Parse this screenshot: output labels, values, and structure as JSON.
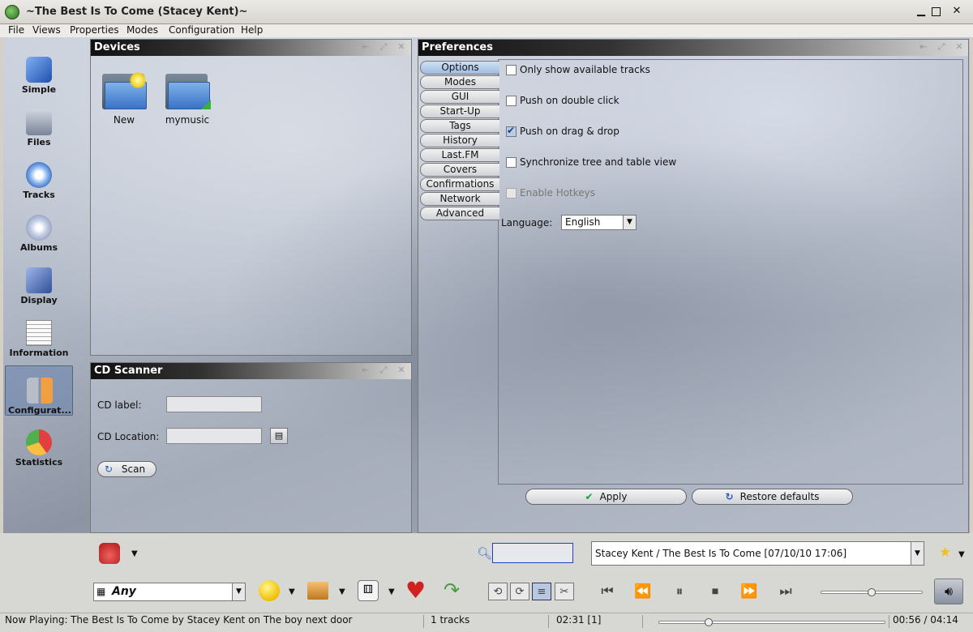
{
  "window": {
    "title": "~The Best Is To Come (Stacey Kent)~"
  },
  "menu": [
    "File",
    "Views",
    "Properties",
    "Modes",
    "Configuration",
    "Help"
  ],
  "perspectives": [
    {
      "label": "Simple",
      "icon": "cube-icon",
      "color": "#3a6fd0"
    },
    {
      "label": "Files",
      "icon": "harddisk-icon",
      "color": "#8a94a8"
    },
    {
      "label": "Tracks",
      "icon": "cd-folder-icon",
      "color": "#6ea0e0"
    },
    {
      "label": "Albums",
      "icon": "cd-stack-icon",
      "color": "#b7c2d6"
    },
    {
      "label": "Display",
      "icon": "magnifier-icon",
      "color": "#5a6fa8"
    },
    {
      "label": "Information",
      "icon": "newspaper-icon",
      "color": "#e8e8e8"
    },
    {
      "label": "Configurat...",
      "icon": "wrench-icon",
      "color": "#f0a040"
    },
    {
      "label": "Statistics",
      "icon": "pie-chart-icon",
      "color": "#e05050"
    }
  ],
  "devices": {
    "title": "Devices",
    "items": [
      {
        "label": "New",
        "icon": "new-folder-icon"
      },
      {
        "label": "mymusic",
        "icon": "folder-icon"
      }
    ]
  },
  "cd_scanner": {
    "title": "CD Scanner",
    "label_field": "CD label:",
    "location_field": "CD Location:",
    "label_value": "",
    "location_value": "",
    "scan_button": "Scan"
  },
  "preferences": {
    "title": "Preferences",
    "tabs": [
      "Options",
      "Modes",
      "GUI",
      "Start-Up",
      "Tags",
      "History",
      "Last.FM",
      "Covers",
      "Confirmations",
      "Network",
      "Advanced"
    ],
    "active_tab": "Options",
    "options": [
      {
        "label": "Only show available tracks",
        "checked": false,
        "enabled": true
      },
      {
        "label": "Push on double click",
        "checked": false,
        "enabled": true
      },
      {
        "label": "Push on drag & drop",
        "checked": true,
        "enabled": true
      },
      {
        "label": "Synchronize tree and table view",
        "checked": false,
        "enabled": true
      },
      {
        "label": "Enable Hotkeys",
        "checked": false,
        "enabled": false
      }
    ],
    "language_label": "Language:",
    "language_value": "English",
    "apply_button": "Apply",
    "restore_button": "Restore defaults"
  },
  "toolbar": {
    "search_value": "",
    "history_value": "Stacey Kent / The Best Is To Come [07/10/10 17:06]",
    "ambience_value": "Any"
  },
  "status": {
    "now_playing_label": "Now Playing:",
    "now_playing_text": "The Best Is To Come by Stacey Kent on The boy next door",
    "tracks": "1 tracks",
    "total_time": "02:31 [1]",
    "position": "00:56 / 04:14",
    "progress_fraction": 0.22,
    "volume_fraction": 0.5
  },
  "colors": {
    "panel_head_dark": "#111111",
    "accent": "#3a72c8"
  }
}
